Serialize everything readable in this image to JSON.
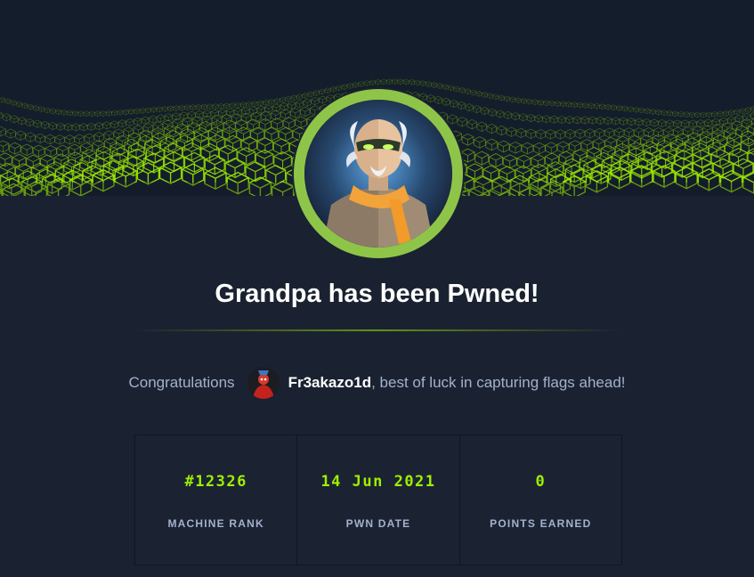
{
  "banner": {
    "accent_color": "#9fef00",
    "machine_avatar_icon": "grandpa-machine-avatar",
    "ring_color": "#8ec549"
  },
  "title": "Grandpa has been Pwned!",
  "congrats": {
    "prefix": "Congratulations",
    "user_avatar_icon": "user-avatar",
    "username": "Fr3akazo1d",
    "suffix": ", best of luck in capturing flags ahead!"
  },
  "stats": [
    {
      "value": "#12326",
      "label": "MACHINE RANK"
    },
    {
      "value": "14 Jun 2021",
      "label": "PWN DATE"
    },
    {
      "value": "0",
      "label": "POINTS EARNED"
    }
  ]
}
